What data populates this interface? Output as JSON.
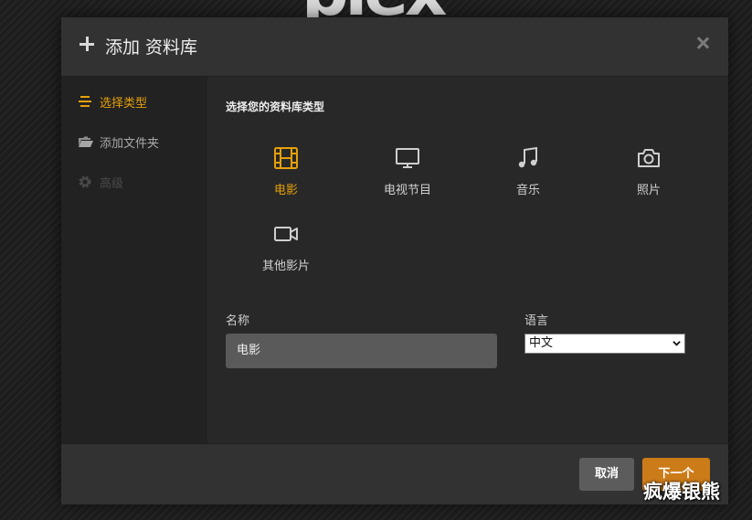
{
  "background": {
    "logo_text": "plex"
  },
  "dialog": {
    "title": "添加 资料库",
    "icons": {
      "header": "plus-icon",
      "close": "close-icon"
    }
  },
  "sidebar": {
    "items": [
      {
        "label": "选择类型",
        "icon": "list-icon",
        "state": "active"
      },
      {
        "label": "添加文件夹",
        "icon": "folder-icon",
        "state": "normal"
      },
      {
        "label": "高级",
        "icon": "gear-icon",
        "state": "disabled"
      }
    ]
  },
  "content": {
    "section_title": "选择您的资料库类型",
    "library_types": [
      {
        "label": "电影",
        "icon": "film-icon",
        "selected": true
      },
      {
        "label": "电视节目",
        "icon": "tv-icon",
        "selected": false
      },
      {
        "label": "音乐",
        "icon": "music-note-icon",
        "selected": false
      },
      {
        "label": "照片",
        "icon": "camera-icon",
        "selected": false
      },
      {
        "label": "其他影片",
        "icon": "video-camera-icon",
        "selected": false
      }
    ],
    "name_field": {
      "label": "名称",
      "value": "电影"
    },
    "language_field": {
      "label": "语言",
      "value": "中文"
    }
  },
  "footer": {
    "cancel_label": "取消",
    "next_label": "下一个"
  },
  "watermark": "疯爆银熊",
  "colors": {
    "accent": "#e5a00d",
    "primary_button": "#cc7b19",
    "secondary_button": "#5c5c5c",
    "modal_bg": "#282828",
    "header_bg": "#323232",
    "sidebar_bg": "#222222"
  }
}
